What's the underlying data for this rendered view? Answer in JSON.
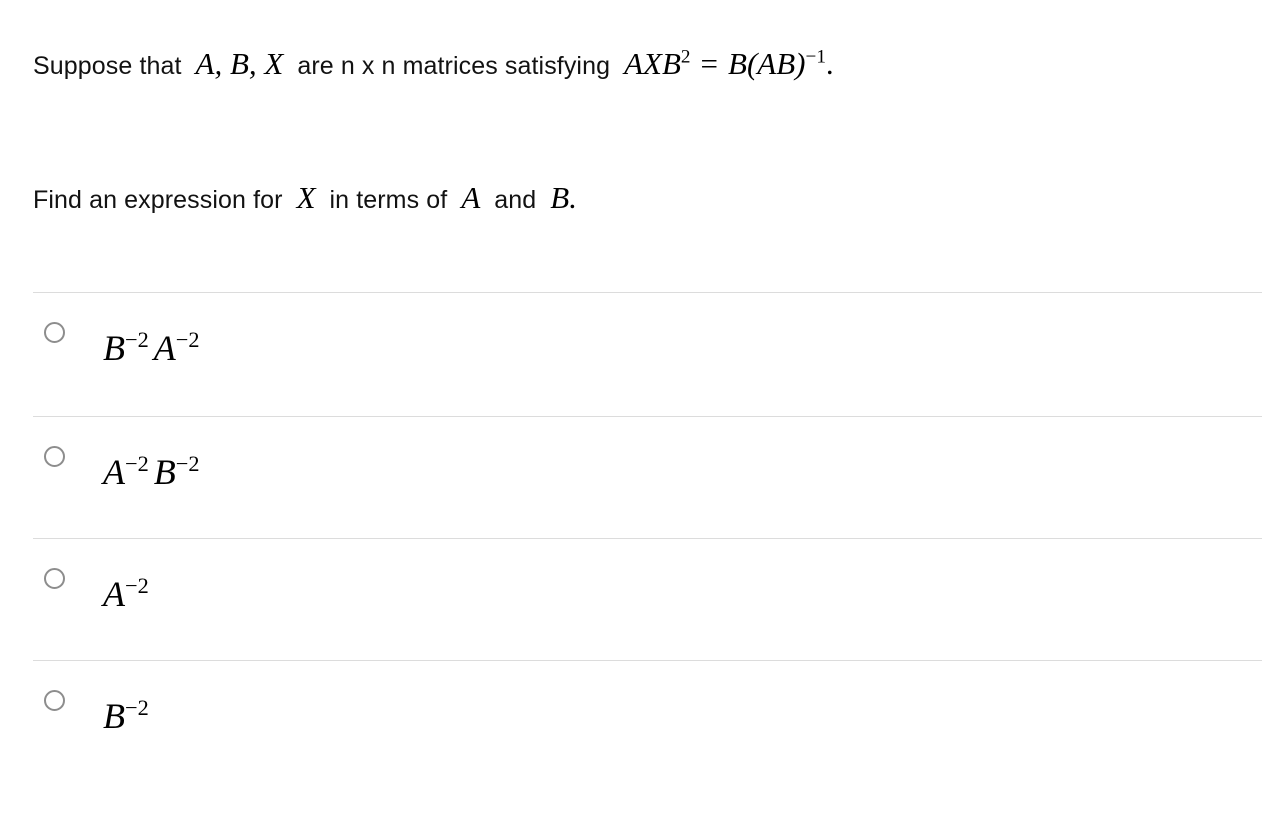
{
  "question": {
    "line1": {
      "text_before": "Suppose that",
      "math_variables": "A, B, X",
      "text_middle": "are n x n matrices satisfying",
      "equation_plain": "AXB^2 = B(AB)^{-1}.",
      "equation_parts": {
        "lhs_base": "AXB",
        "lhs_exponent": "2",
        "relation": "=",
        "rhs_prefix": "B(AB)",
        "rhs_exponent": "−1",
        "period": "."
      }
    },
    "line2": {
      "text_before": "Find an expression for",
      "math_variable_x": "X",
      "text_middle": "in terms of",
      "math_variable_a": "A",
      "text_and": "and",
      "math_variable_b": "B."
    }
  },
  "options": [
    {
      "id": "option-1",
      "plain": "B^{-2} A^{-2}",
      "terms": [
        {
          "base": "B",
          "exponent": "−2"
        },
        {
          "base": "A",
          "exponent": "−2"
        }
      ],
      "selected": false
    },
    {
      "id": "option-2",
      "plain": "A^{-2} B^{-2}",
      "terms": [
        {
          "base": "A",
          "exponent": "−2"
        },
        {
          "base": "B",
          "exponent": "−2"
        }
      ],
      "selected": false
    },
    {
      "id": "option-3",
      "plain": "A^{-2}",
      "terms": [
        {
          "base": "A",
          "exponent": "−2"
        }
      ],
      "selected": false
    },
    {
      "id": "option-4",
      "plain": "B^{-2}",
      "terms": [
        {
          "base": "B",
          "exponent": "−2"
        }
      ],
      "selected": false
    }
  ],
  "colors": {
    "background": "#ffffff",
    "text": "#121212",
    "math": "#000000",
    "divider": "#dcdcdc",
    "radio_border": "#8d8d8d"
  }
}
